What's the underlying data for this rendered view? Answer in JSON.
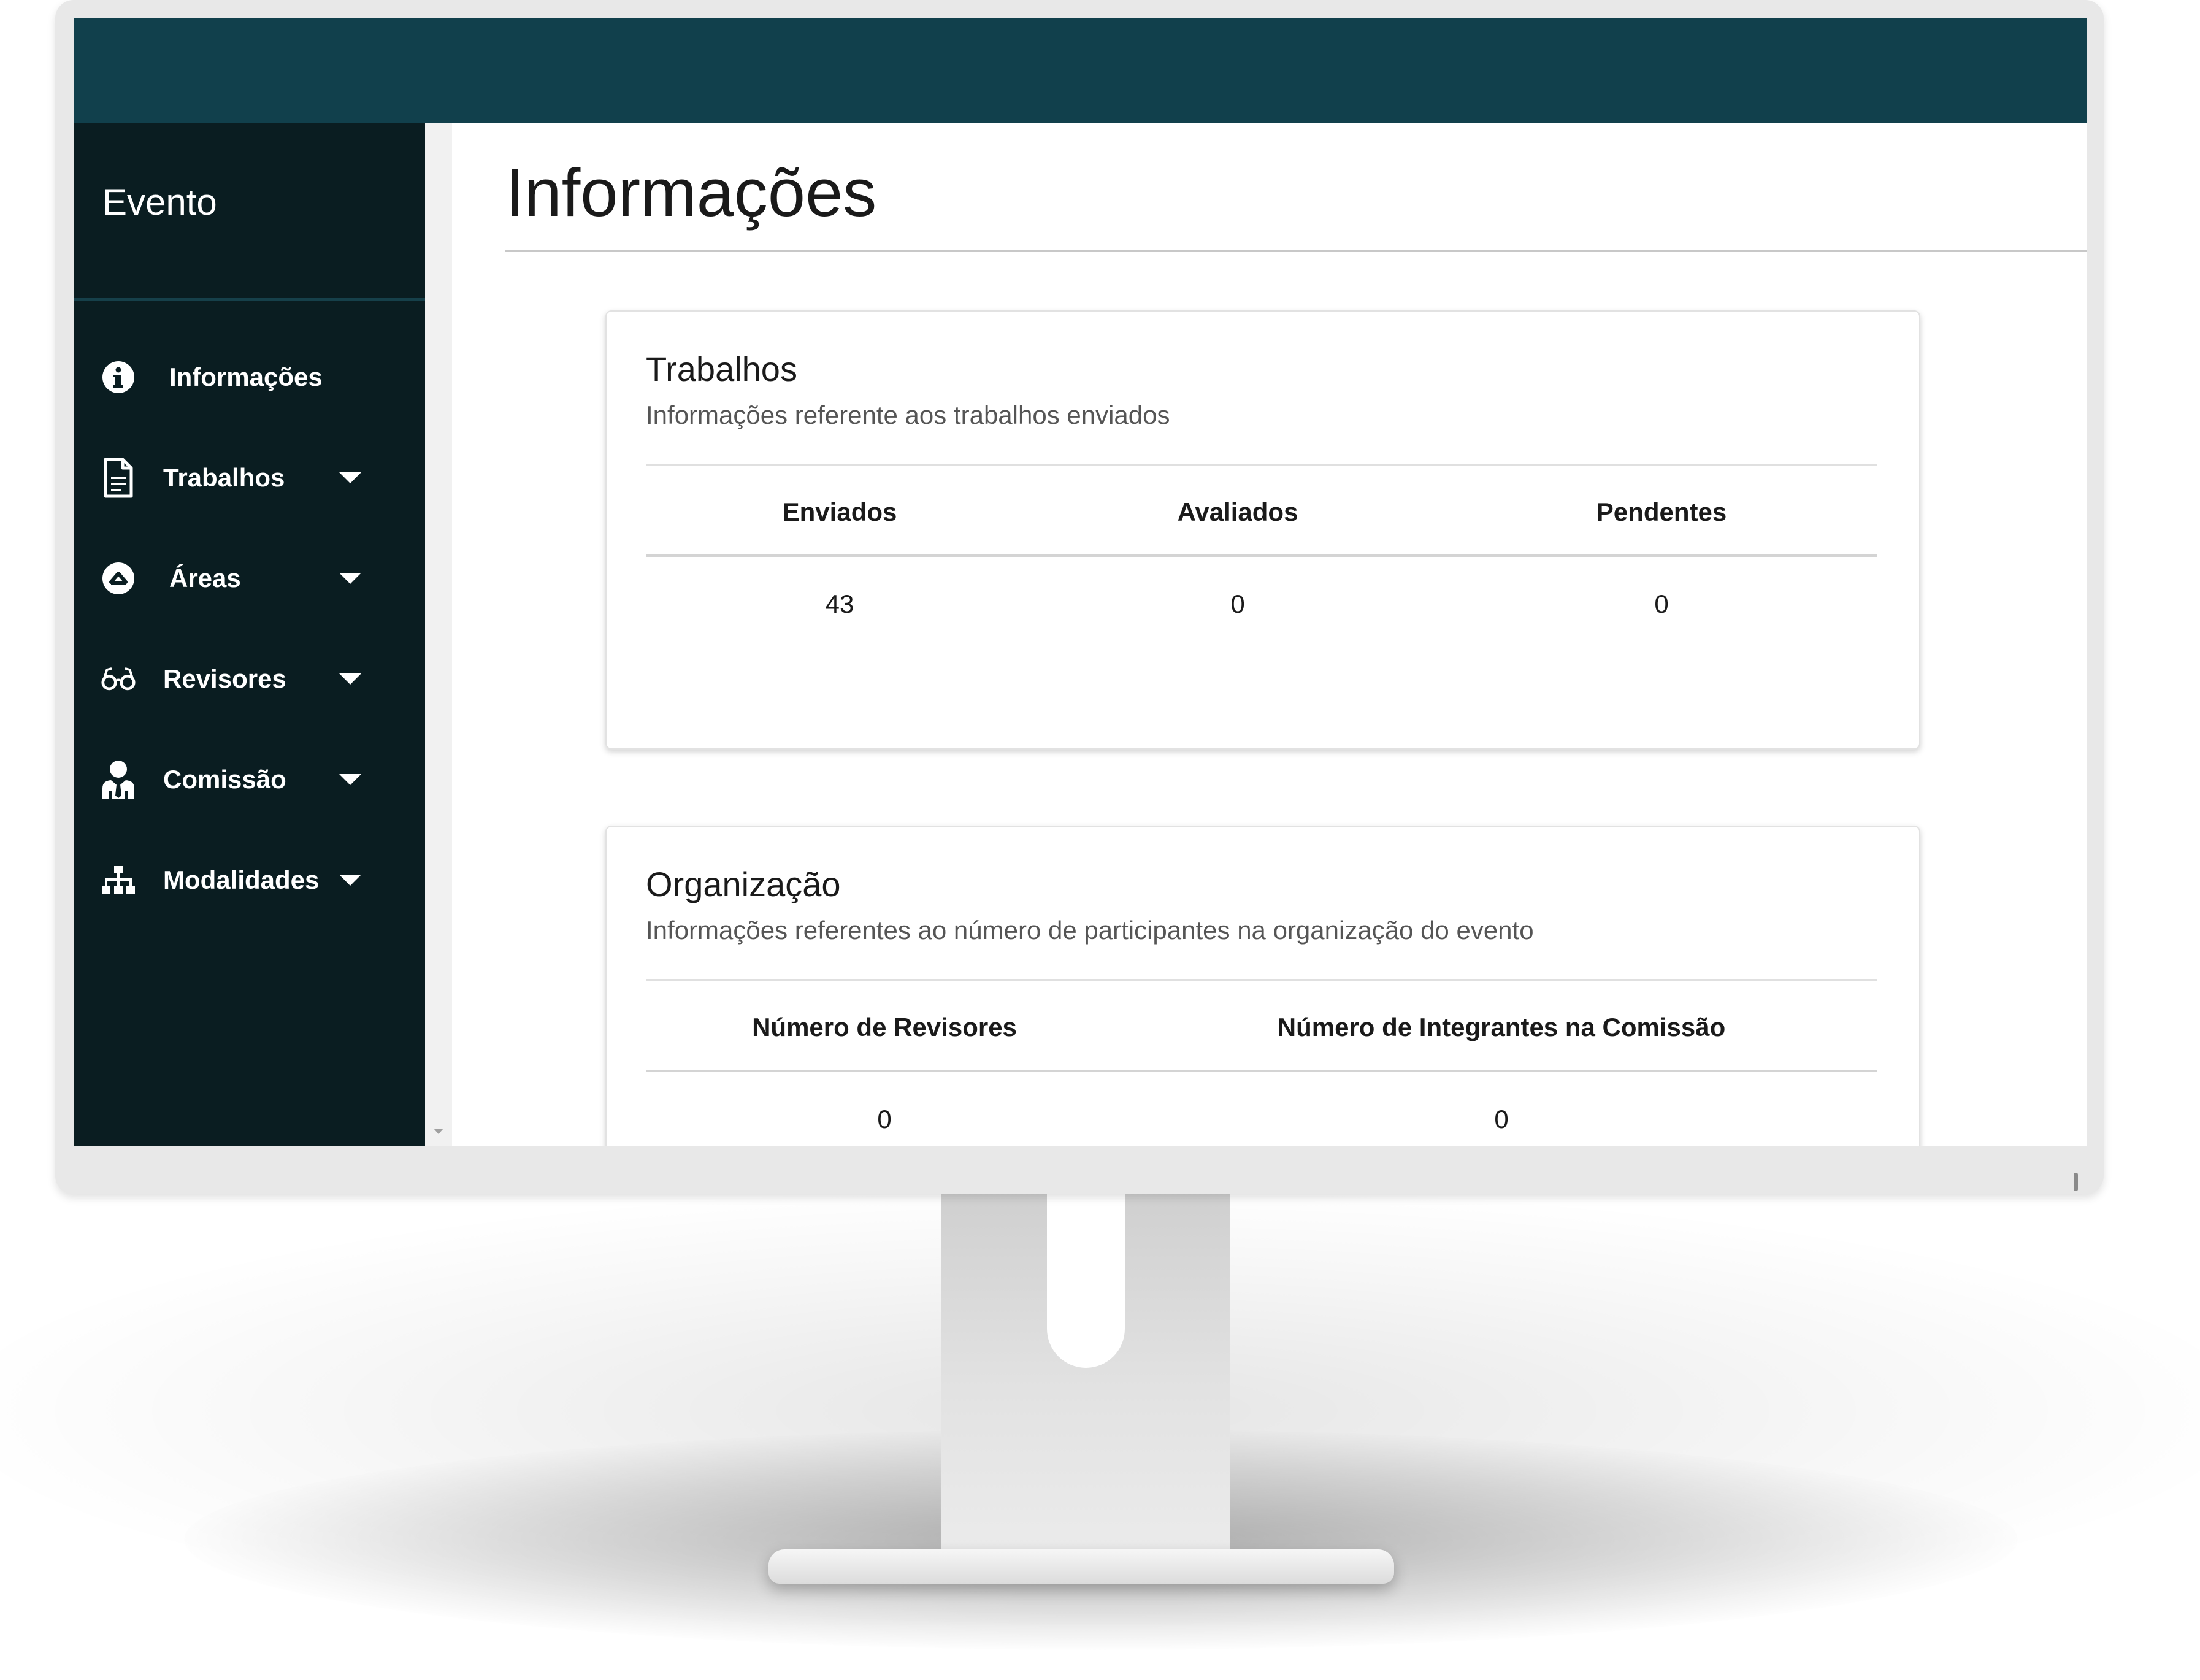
{
  "sidebar": {
    "title": "Evento",
    "items": [
      {
        "label": "Informações",
        "icon": "info-circle-icon",
        "has_dropdown": false
      },
      {
        "label": "Trabalhos",
        "icon": "file-text-icon",
        "has_dropdown": true
      },
      {
        "label": "Áreas",
        "icon": "chevron-up-circle-icon",
        "has_dropdown": true
      },
      {
        "label": "Revisores",
        "icon": "glasses-icon",
        "has_dropdown": true
      },
      {
        "label": "Comissão",
        "icon": "user-tie-icon",
        "has_dropdown": true
      },
      {
        "label": "Modalidades",
        "icon": "sitemap-icon",
        "has_dropdown": true
      }
    ]
  },
  "main": {
    "title": "Informações",
    "trabalhos": {
      "title": "Trabalhos",
      "subtitle": "Informações referente aos trabalhos enviados",
      "columns": [
        "Enviados",
        "Avaliados",
        "Pendentes"
      ],
      "values": [
        "43",
        "0",
        "0"
      ]
    },
    "organizacao": {
      "title": "Organização",
      "subtitle": "Informações referentes ao número de participantes na organização do evento",
      "columns": [
        "Número de Revisores",
        "Número de Integrantes na Comissão"
      ],
      "values": [
        "0",
        "0"
      ]
    }
  },
  "colors": {
    "topbar": "#11404c",
    "sidebar": "#0a1d21",
    "bezel": "#e8e8e8"
  }
}
